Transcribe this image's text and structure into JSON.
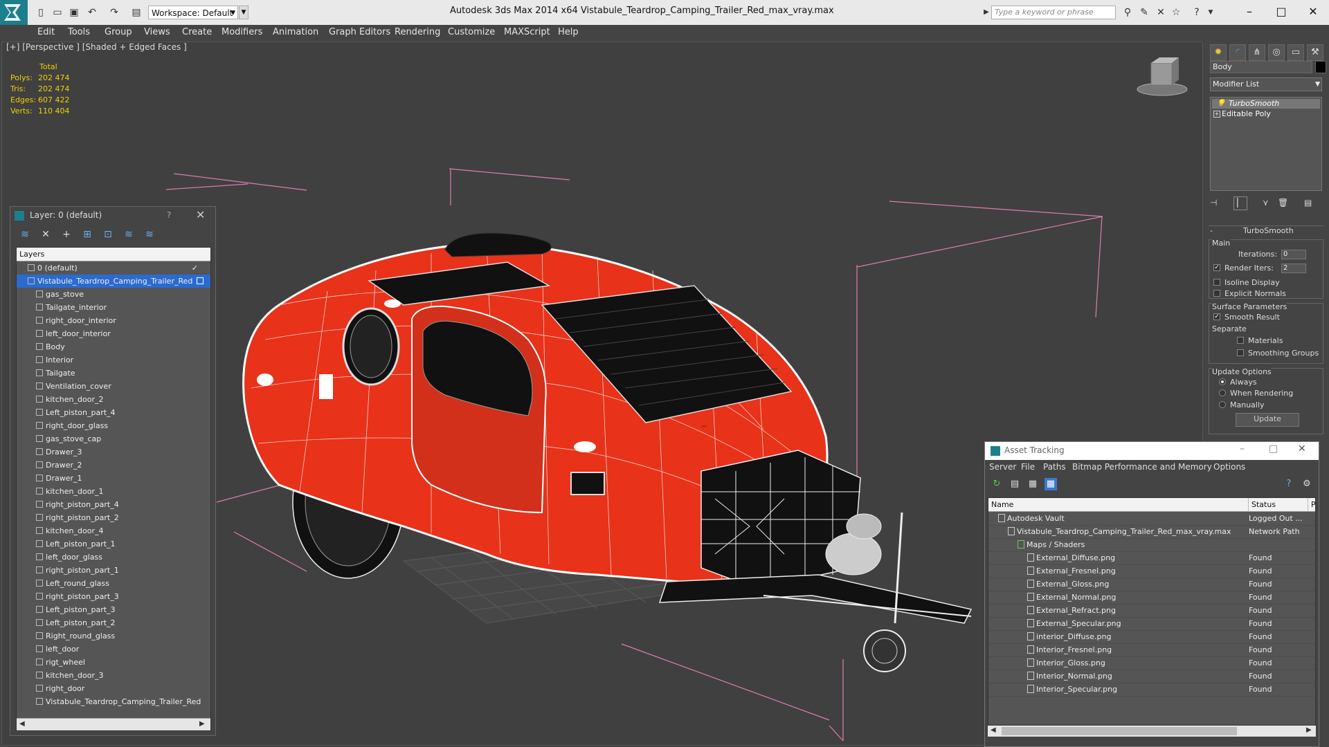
{
  "titlebar": {
    "workspace": "Workspace: Default",
    "title": "Autodesk 3ds Max  2014 x64      Vistabule_Teardrop_Camping_Trailer_Red_max_vray.max",
    "search_placeholder": "Type a keyword or phrase"
  },
  "menu": [
    "Edit",
    "Tools",
    "Group",
    "Views",
    "Create",
    "Modifiers",
    "Animation",
    "Graph Editors",
    "Rendering",
    "Customize",
    "MAXScript",
    "Help"
  ],
  "viewport": {
    "label": "[+] [Perspective ] [Shaded + Edged Faces ]",
    "stats": {
      "header": "Total",
      "rows": [
        {
          "label": "Polys:",
          "value": "202 474"
        },
        {
          "label": "Tris:",
          "value": "202 474"
        },
        {
          "label": "Edges:",
          "value": "607 422"
        },
        {
          "label": "Verts:",
          "value": "110 404"
        }
      ]
    },
    "colors": {
      "trailer": "#e8321a",
      "background": "#404040",
      "grid_box": "#e080b0"
    }
  },
  "command_panel": {
    "object_name": "Body",
    "modifier_list": "Modifier List",
    "stack": [
      "TurboSmooth",
      "Editable Poly"
    ],
    "rollout_title": "TurboSmooth",
    "main_label": "Main",
    "iterations_label": "Iterations:",
    "iterations_value": "0",
    "render_iters_label": "Render Iters:",
    "render_iters_value": "2",
    "isoline": "Isoline Display",
    "explicit_normals": "Explicit Normals",
    "surface_params": "Surface Parameters",
    "smooth_result": "Smooth Result",
    "separate": "Separate",
    "materials": "Materials",
    "smoothing_groups": "Smoothing Groups",
    "update_options": "Update Options",
    "always": "Always",
    "when_rendering": "When Rendering",
    "manually": "Manually",
    "update_button": "Update"
  },
  "layer_panel": {
    "title": "Layer: 0 (default)",
    "help": "?",
    "header": "Layers",
    "layers": [
      {
        "name": "0 (default)",
        "level": 1,
        "selected": false
      },
      {
        "name": "Vistabule_Teardrop_Camping_Trailer_Red",
        "level": 1,
        "selected": true
      },
      {
        "name": "gas_stove",
        "level": 2
      },
      {
        "name": "Tailgate_interior",
        "level": 2
      },
      {
        "name": "right_door_interior",
        "level": 2
      },
      {
        "name": "left_door_interior",
        "level": 2
      },
      {
        "name": "Body",
        "level": 2
      },
      {
        "name": "Interior",
        "level": 2
      },
      {
        "name": "Tailgate",
        "level": 2
      },
      {
        "name": "Ventilation_cover",
        "level": 2
      },
      {
        "name": "kitchen_door_2",
        "level": 2
      },
      {
        "name": "Left_piston_part_4",
        "level": 2
      },
      {
        "name": "right_door_glass",
        "level": 2
      },
      {
        "name": "gas_stove_cap",
        "level": 2
      },
      {
        "name": "Drawer_3",
        "level": 2
      },
      {
        "name": "Drawer_2",
        "level": 2
      },
      {
        "name": "Drawer_1",
        "level": 2
      },
      {
        "name": "kitchen_door_1",
        "level": 2
      },
      {
        "name": "right_piston_part_4",
        "level": 2
      },
      {
        "name": "right_piston_part_2",
        "level": 2
      },
      {
        "name": "kitchen_door_4",
        "level": 2
      },
      {
        "name": "Left_piston_part_1",
        "level": 2
      },
      {
        "name": "left_door_glass",
        "level": 2
      },
      {
        "name": "right_piston_part_1",
        "level": 2
      },
      {
        "name": "Left_round_glass",
        "level": 2
      },
      {
        "name": "right_piston_part_3",
        "level": 2
      },
      {
        "name": "Left_piston_part_3",
        "level": 2
      },
      {
        "name": "Left_piston_part_2",
        "level": 2
      },
      {
        "name": "Right_round_glass",
        "level": 2
      },
      {
        "name": "left_door",
        "level": 2
      },
      {
        "name": "rigt_wheel",
        "level": 2
      },
      {
        "name": "kitchen_door_3",
        "level": 2
      },
      {
        "name": "right_door",
        "level": 2
      },
      {
        "name": "Vistabule_Teardrop_Camping_Trailer_Red",
        "level": 2
      }
    ]
  },
  "asset_tracking": {
    "title": "Asset Tracking",
    "menu": [
      "Server",
      "File",
      "Paths",
      "Bitmap Performance and Memory",
      "Options"
    ],
    "col_name": "Name",
    "col_status": "Status",
    "col_extra": "P",
    "rows": [
      {
        "name": "Autodesk Vault",
        "status": "Logged Out ...",
        "level": 1
      },
      {
        "name": "Vistabule_Teardrop_Camping_Trailer_Red_max_vray.max",
        "status": "Network Path",
        "level": 2
      },
      {
        "name": "Maps / Shaders",
        "status": "",
        "level": 3
      },
      {
        "name": "External_Diffuse.png",
        "status": "Found",
        "level": 4
      },
      {
        "name": "External_Fresnel.png",
        "status": "Found",
        "level": 4
      },
      {
        "name": "External_Gloss.png",
        "status": "Found",
        "level": 4
      },
      {
        "name": "External_Normal.png",
        "status": "Found",
        "level": 4
      },
      {
        "name": "External_Refract.png",
        "status": "Found",
        "level": 4
      },
      {
        "name": "External_Specular.png",
        "status": "Found",
        "level": 4
      },
      {
        "name": "interior_Diffuse.png",
        "status": "Found",
        "level": 4
      },
      {
        "name": "Interior_Fresnel.png",
        "status": "Found",
        "level": 4
      },
      {
        "name": "Interior_Gloss.png",
        "status": "Found",
        "level": 4
      },
      {
        "name": "Interior_Normal.png",
        "status": "Found",
        "level": 4
      },
      {
        "name": "Interior_Specular.png",
        "status": "Found",
        "level": 4
      }
    ]
  }
}
